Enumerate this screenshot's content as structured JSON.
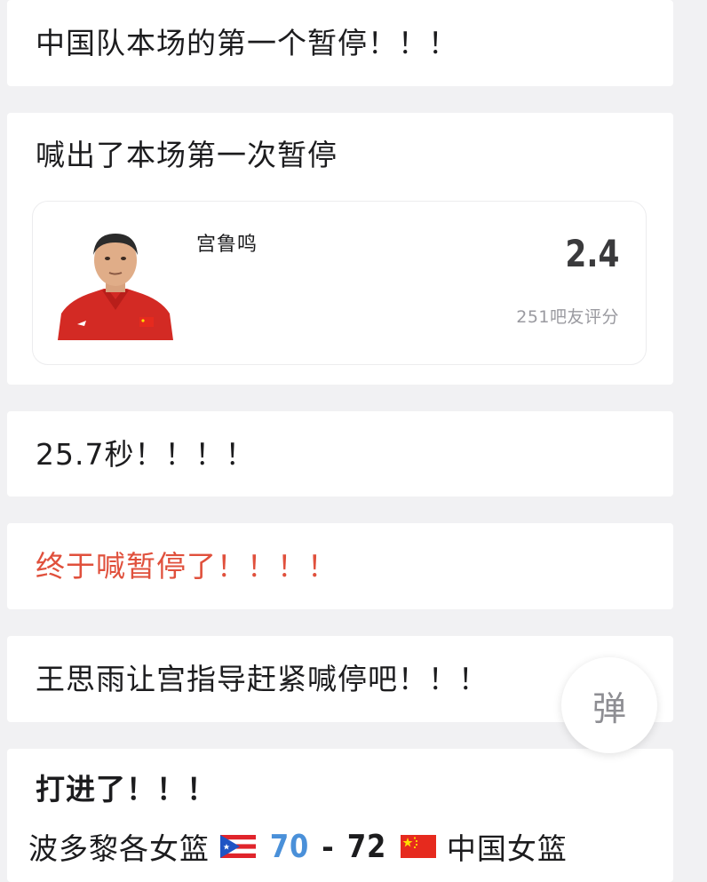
{
  "posts": [
    {
      "text": "中国队本场的第一个暂停！！！"
    },
    {
      "text": "喊出了本场第一次暂停"
    },
    {
      "text": "25.7秒！！！！"
    },
    {
      "text": "终于喊暂停了！！！！",
      "color": "#e0503c"
    },
    {
      "text": "王思雨让宫指导赶紧喊停吧！！！"
    },
    {
      "text": "打进了！！！"
    }
  ],
  "player_card": {
    "name": "宫鲁鸣",
    "rating": "2.4",
    "rating_count": "251吧友评分"
  },
  "danmaku_button": {
    "label": "弹"
  },
  "score": {
    "team_a": "波多黎各女篮",
    "team_a_flag": "puerto-rico-flag",
    "score_a": "70",
    "separator": "-",
    "score_b": "72",
    "team_b_flag": "china-flag",
    "team_b": "中国女篮",
    "score_a_color": "#4a90d9"
  }
}
